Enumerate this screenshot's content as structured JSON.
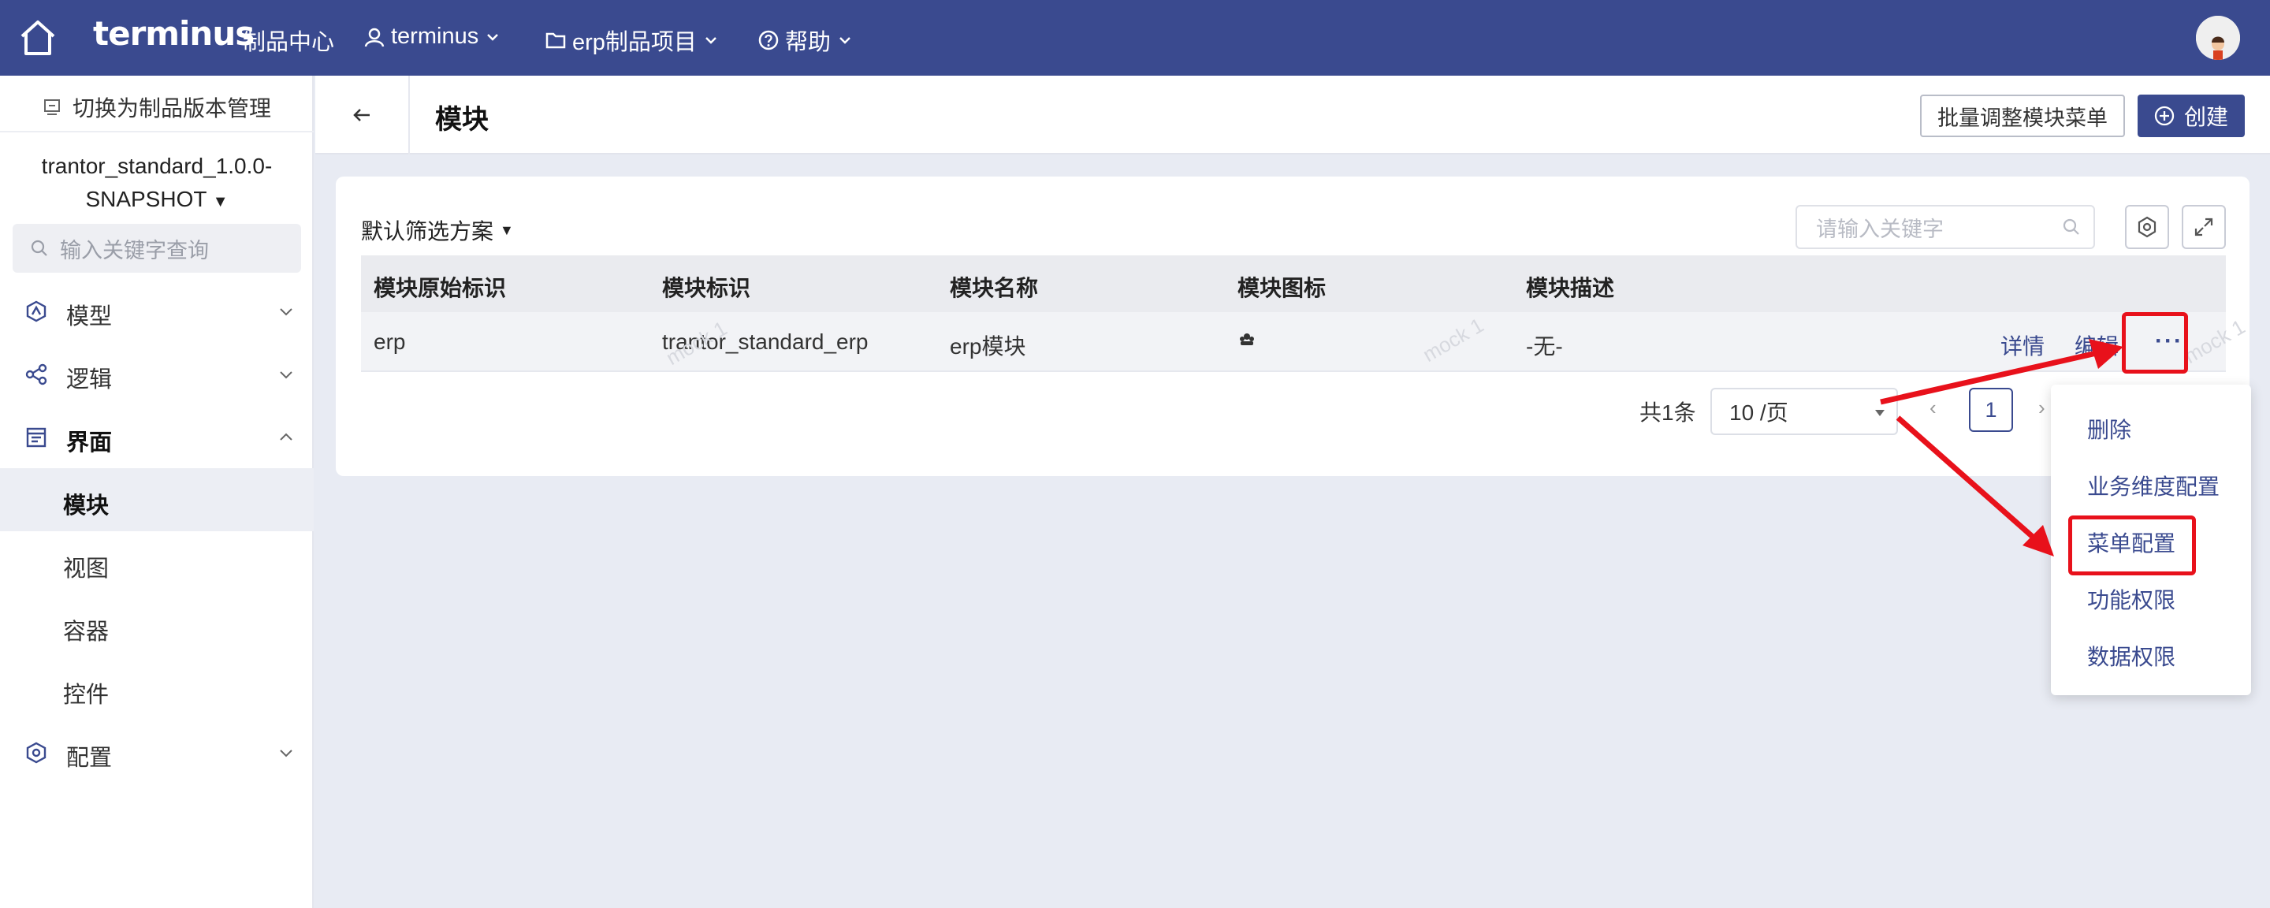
{
  "topbar": {
    "brand": "terminus",
    "product_center": "制品中心",
    "user": "terminus",
    "project": "erp制品项目",
    "help": "帮助"
  },
  "sidebar": {
    "switch_label": "切换为制品版本管理",
    "project_name_line1": "trantor_standard_1.0.0-",
    "project_name_line2": "SNAPSHOT",
    "search_placeholder": "输入关键字查询",
    "items": [
      {
        "label": "模型"
      },
      {
        "label": "逻辑"
      },
      {
        "label": "界面"
      },
      {
        "label": "模块"
      },
      {
        "label": "视图"
      },
      {
        "label": "容器"
      },
      {
        "label": "控件"
      },
      {
        "label": "配置"
      }
    ]
  },
  "header": {
    "title": "模块",
    "batch_button": "批量调整模块菜单",
    "create_button": "创建"
  },
  "toolbar": {
    "filter_scheme": "默认筛选方案",
    "keyword_placeholder": "请输入关键字"
  },
  "table": {
    "columns": [
      "模块原始标识",
      "模块标识",
      "模块名称",
      "模块图标",
      "模块描述"
    ],
    "rows": [
      {
        "original_key": "erp",
        "key": "trantor_standard_erp",
        "name": "erp模块",
        "description": "-无-",
        "actions": [
          "详情",
          "编辑"
        ]
      }
    ]
  },
  "pagination": {
    "total": "共1条",
    "page_size": "10 /页",
    "current_page": "1"
  },
  "dropdown": {
    "items": [
      "删除",
      "业务维度配置",
      "菜单配置",
      "功能权限",
      "数据权限"
    ]
  },
  "watermark": "mock 1",
  "colors": {
    "brand": "#3a4a8f",
    "highlight": "#e8111b"
  }
}
